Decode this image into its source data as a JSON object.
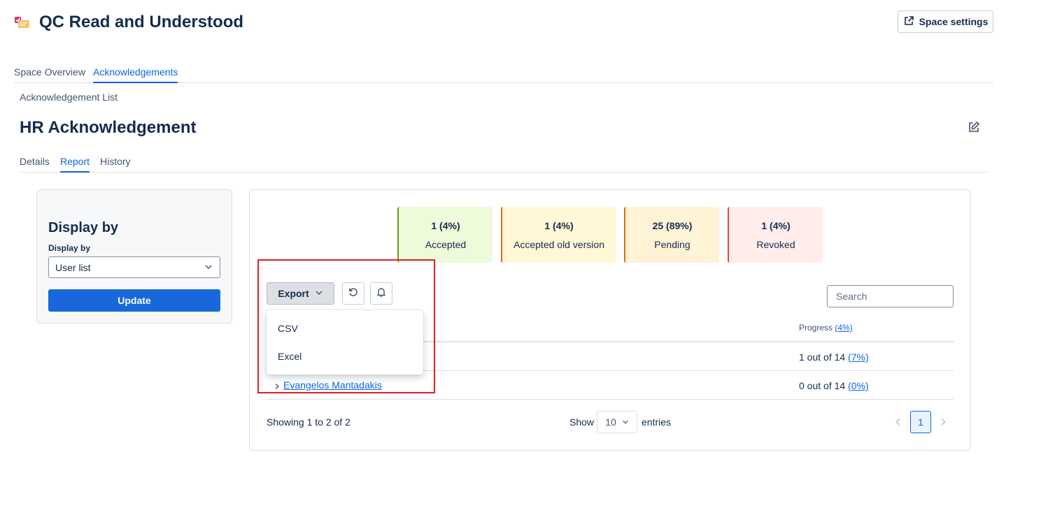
{
  "space": {
    "title": "QC Read and Understood",
    "settings_label": "Space settings"
  },
  "top_tabs": [
    {
      "label": "Space Overview",
      "active": false
    },
    {
      "label": "Acknowledgements",
      "active": true
    }
  ],
  "breadcrumb": "Acknowledgement List",
  "page_title": "HR Acknowledgement",
  "sub_tabs": [
    {
      "label": "Details",
      "active": false
    },
    {
      "label": "Report",
      "active": true
    },
    {
      "label": "History",
      "active": false
    }
  ],
  "display_panel": {
    "heading": "Display by",
    "field_label": "Display by",
    "selected": "User list",
    "update_label": "Update"
  },
  "stats": [
    {
      "count": "1 (4%)",
      "label": "Accepted",
      "bg": "#eefbda",
      "border": "#6a9a23"
    },
    {
      "count": "1 (4%)",
      "label": "Accepted old version",
      "bg": "#fff7d6",
      "border": "#e06c00"
    },
    {
      "count": "25 (89%)",
      "label": "Pending",
      "bg": "#fff3d6",
      "border": "#e06c00"
    },
    {
      "count": "1 (4%)",
      "label": "Revoked",
      "bg": "#ffeceb",
      "border": "#e2483d"
    }
  ],
  "toolbar": {
    "export_label": "Export",
    "refresh_icon": "refresh-icon",
    "bell_icon": "bell-icon",
    "search_placeholder": "Search"
  },
  "export_menu": {
    "items": [
      "CSV",
      "Excel"
    ]
  },
  "table": {
    "progress_header": "Progress",
    "progress_header_pct": "(4%)",
    "rows": [
      {
        "name": "",
        "progress": "1 out of 14",
        "pct": "(7%)"
      },
      {
        "name": "Evangelos Mantadakis",
        "progress": "0 out of 14",
        "pct": "(0%)"
      }
    ]
  },
  "footer": {
    "showing": "Showing 1 to 2 of 2",
    "show_label": "Show",
    "page_size": "10",
    "entries_label": "entries",
    "current_page": "1"
  },
  "colors": {
    "accent": "#0c66e4",
    "primary_button": "#1868db",
    "highlight": "#e02020"
  }
}
